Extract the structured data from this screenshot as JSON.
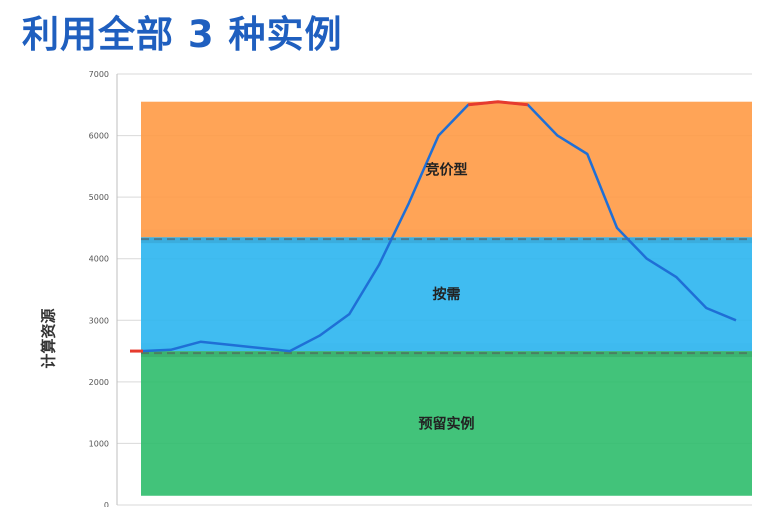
{
  "slide": {
    "title": "利用全部 3 种实例"
  },
  "chart_data": {
    "type": "line",
    "title": "",
    "xlabel": "",
    "ylabel": "计算资源",
    "ylim": [
      0,
      7000
    ],
    "yticks": [
      0,
      1000,
      2000,
      3000,
      4000,
      5000,
      6000,
      7000
    ],
    "grid": true,
    "bands": [
      {
        "label": "预留实例",
        "from": 150,
        "to": 2500,
        "color": "#2ebd6b"
      },
      {
        "label": "按需",
        "from": 2500,
        "to": 4350,
        "color": "#2bb5f0"
      },
      {
        "label": "竞价型",
        "from": 4350,
        "to": 6550,
        "color": "#ff9a45"
      }
    ],
    "series": [
      {
        "name": "",
        "color": "#1f6fd6",
        "peak_color": "#e63b2e",
        "values": [
          2500,
          2520,
          2650,
          2600,
          2550,
          2500,
          2750,
          3100,
          3900,
          4900,
          6000,
          6500,
          6550,
          6500,
          6000,
          5700,
          4500,
          4000,
          3700,
          3200,
          3000
        ]
      }
    ]
  }
}
